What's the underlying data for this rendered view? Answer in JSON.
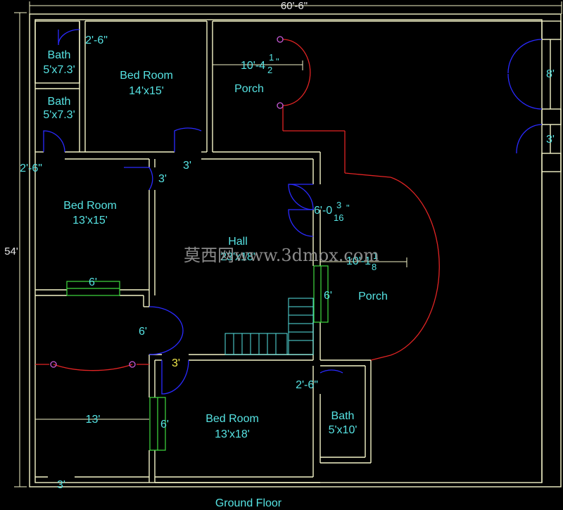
{
  "plan": {
    "overall_width": "60'-6\"",
    "overall_depth": "54'",
    "floor_title": "Ground Floor",
    "watermark": "莫西网www.3dmox.com"
  },
  "rooms": {
    "bath1": {
      "name": "Bath",
      "size": "5'x7.3'"
    },
    "bath2": {
      "name": "Bath",
      "size": "5'x7.3'"
    },
    "bed1": {
      "name": "Bed Room",
      "size": "14'x15'"
    },
    "bed2": {
      "name": "Bed Room",
      "size": "13'x15'"
    },
    "bed3": {
      "name": "Bed Room",
      "size": "13'x18'"
    },
    "bath3": {
      "name": "Bath",
      "size": "5'x10'"
    },
    "porch1": {
      "name": "Porch",
      "dim": "10'-4"
    },
    "porch2": {
      "name": "Porch",
      "dim": "10'-1"
    },
    "hall": {
      "name": "Hall",
      "size": "23'x18'"
    }
  },
  "dims": {
    "door_bath1": "2'-6\"",
    "door_left": "2'-6\"",
    "door_bed1": "3'",
    "door_bed2": "3'",
    "win_bed2": "6'",
    "door_hall_left": "6'",
    "door_bed3": "3'",
    "win_bed3": "6'",
    "width_left": "13'",
    "door_bottom": "3'",
    "door_bath3": "2'-6\"",
    "hall_porch_door": "6'-0",
    "hall_porch_win": "6'",
    "gate_large": "8'",
    "gate_small": "3'",
    "frac1_num": "1",
    "frac1_den": "2",
    "frac2_num": "3",
    "frac2_den": "16",
    "frac3_num": "1",
    "frac3_den": "8"
  },
  "colors": {
    "wall": "#f4f4c8",
    "label": "#56e3e3",
    "door": "#2a2aff",
    "arc": "#e22424",
    "window": "#3fdc3f",
    "dim": "#e8e8e8"
  }
}
